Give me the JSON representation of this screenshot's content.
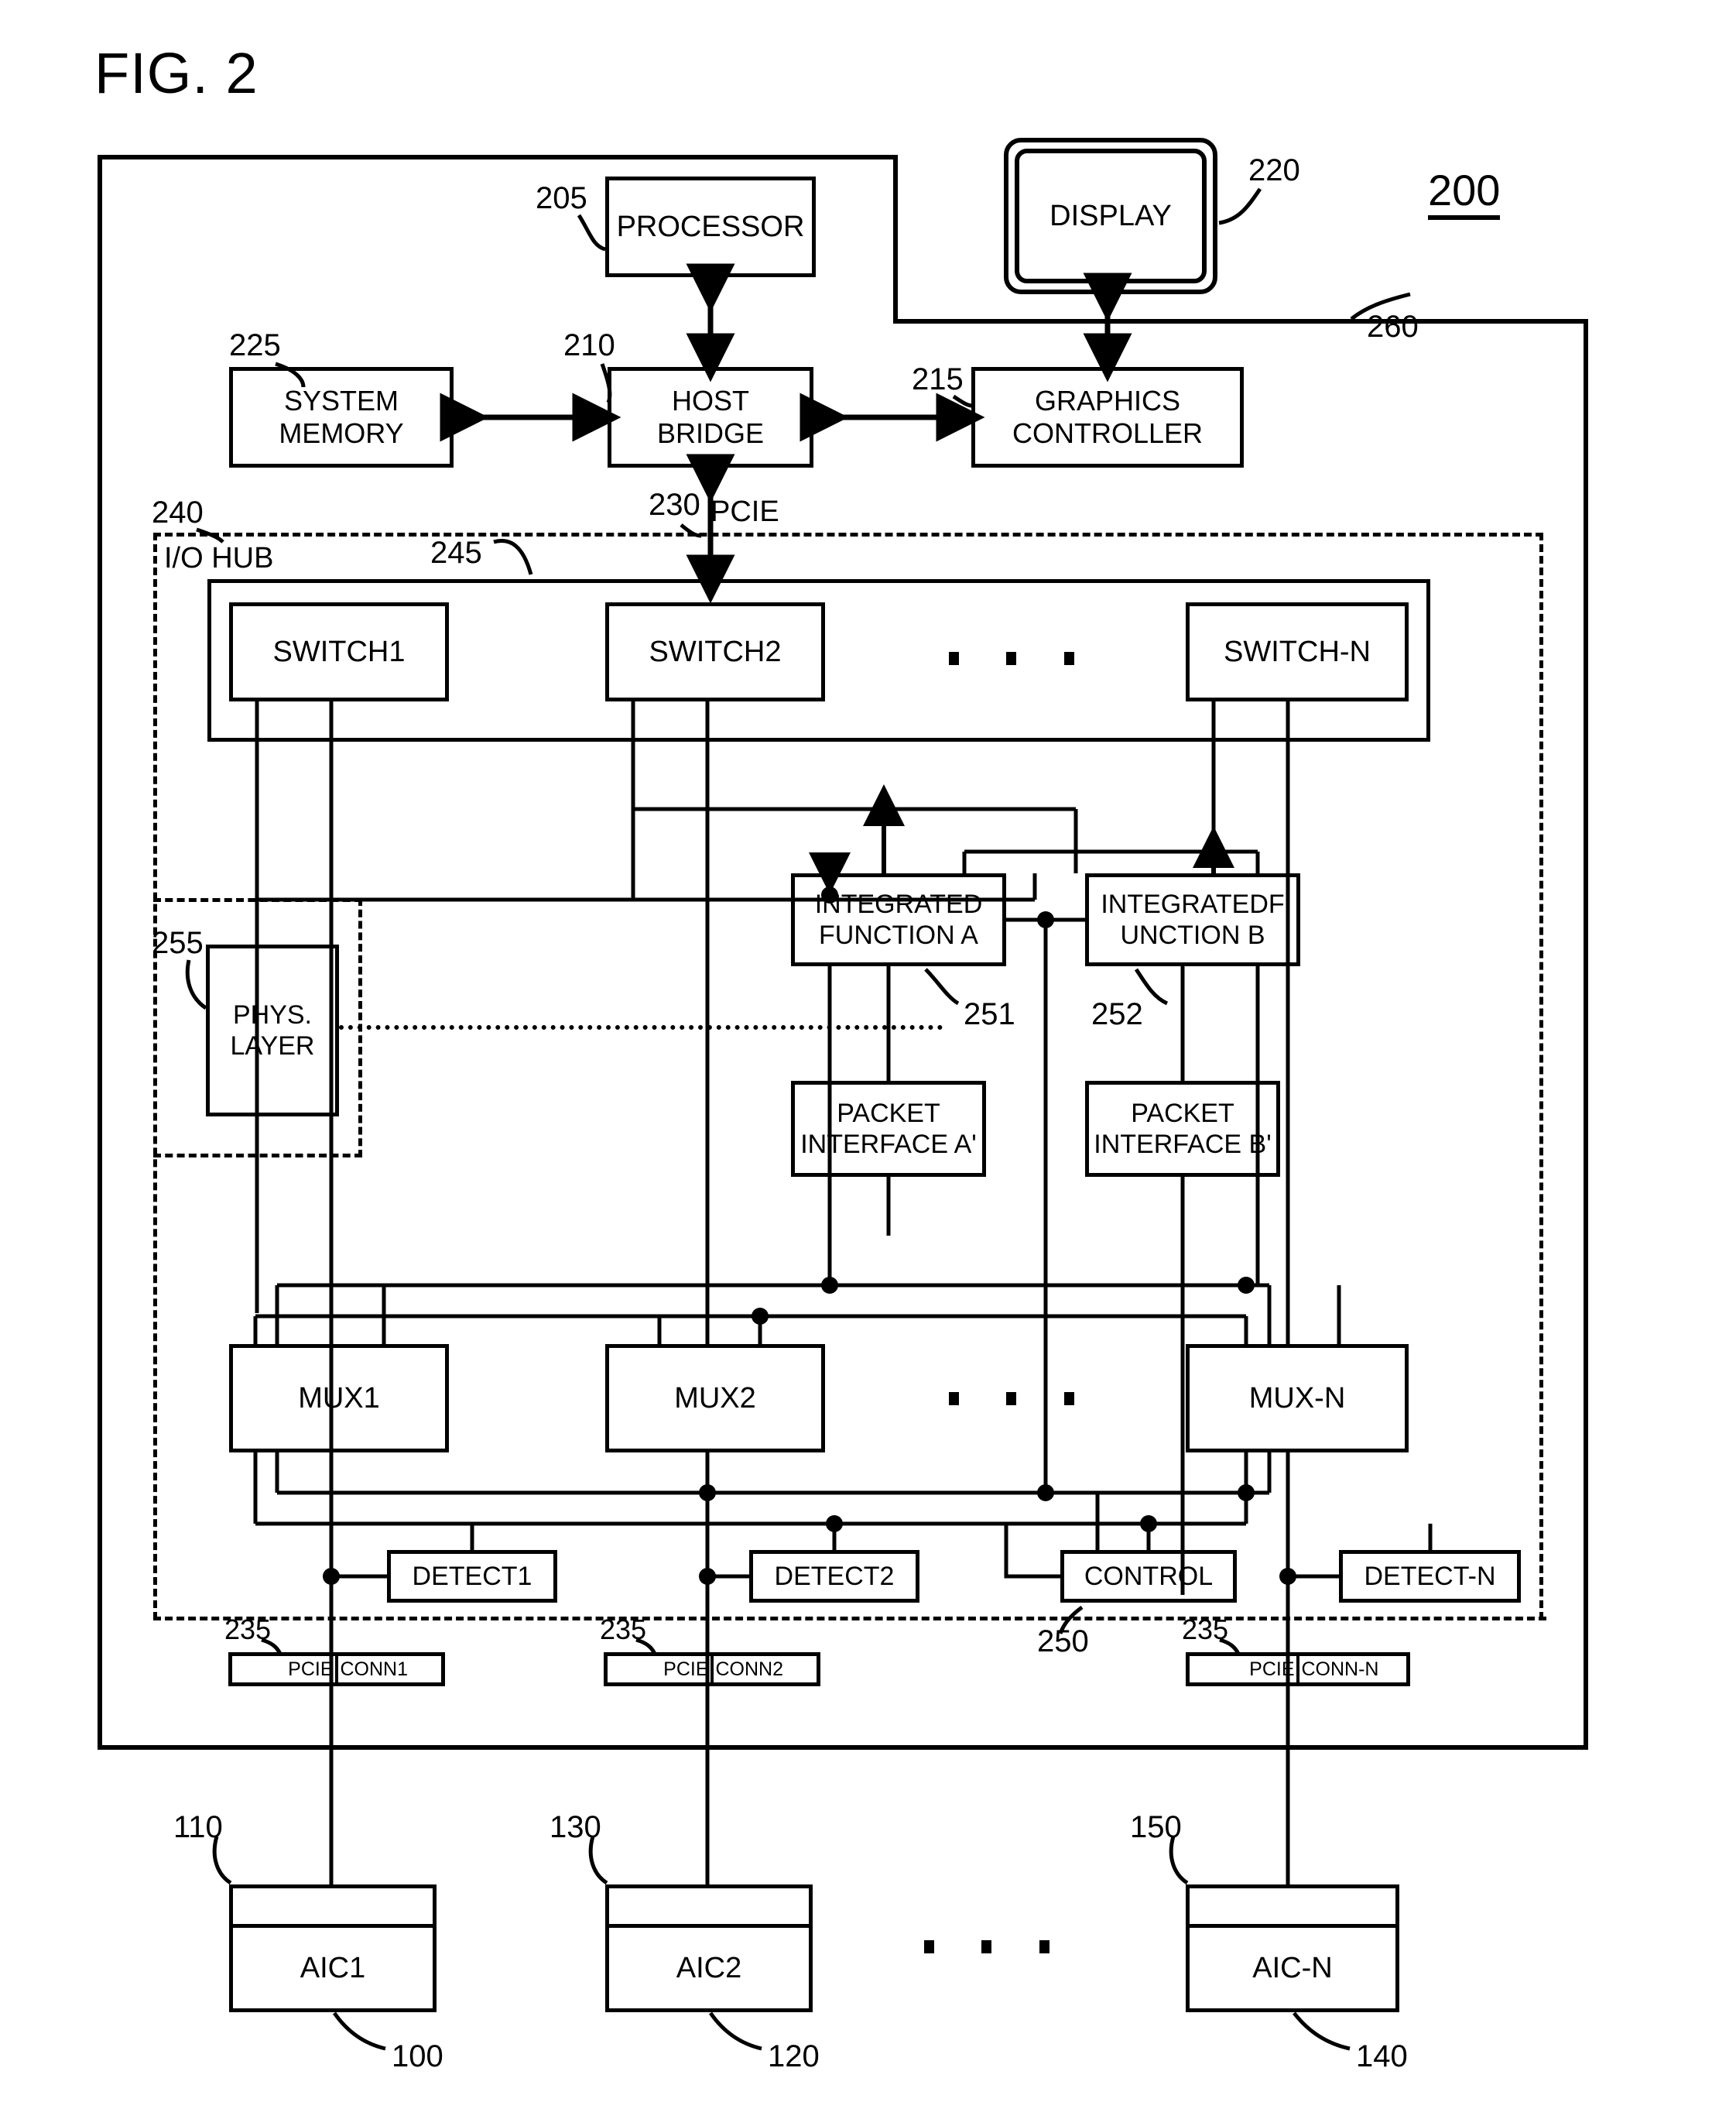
{
  "figure": {
    "title": "FIG. 2",
    "system_ref": "200"
  },
  "blocks": {
    "processor": {
      "label": "PROCESSOR",
      "ref": "205"
    },
    "display": {
      "label": "DISPLAY",
      "ref": "220"
    },
    "system_memory": {
      "label": "SYSTEM\nMEMORY",
      "ref": "225"
    },
    "host_bridge": {
      "label": "HOST\nBRIDGE",
      "ref": "210"
    },
    "graphics": {
      "label": "GRAPHICS\nCONTROLLER",
      "ref": "215"
    },
    "pcie_link": {
      "label": "PCIE",
      "ref": "230"
    },
    "io_hub": {
      "label": "I/O HUB",
      "ref": "240"
    },
    "switch_bus": {
      "ref": "245"
    },
    "switch1": {
      "label": "SWITCH1"
    },
    "switch2": {
      "label": "SWITCH2"
    },
    "switchn": {
      "label": "SWITCH-N"
    },
    "int_func_a": {
      "label": "INTEGRATED\nFUNCTION A",
      "ref": "251"
    },
    "int_func_b": {
      "label": "INTEGRATEDF\nUNCTION B",
      "ref": "252"
    },
    "phys_layer": {
      "label": "PHYS.\nLAYER",
      "ref": "255"
    },
    "pkt_if_a": {
      "label": "PACKET\nINTERFACE A'"
    },
    "pkt_if_b": {
      "label": "PACKET\nINTERFACE B'"
    },
    "mux1": {
      "label": "MUX1"
    },
    "mux2": {
      "label": "MUX2"
    },
    "muxn": {
      "label": "MUX-N"
    },
    "detect1": {
      "label": "DETECT1"
    },
    "detect2": {
      "label": "DETECT2"
    },
    "detectn": {
      "label": "DETECT-N"
    },
    "control": {
      "label": "CONTROL",
      "ref": "250"
    },
    "chassis": {
      "ref": "260"
    }
  },
  "connectors": [
    {
      "left": "PCIE",
      "right": "CONN1",
      "ref": "235"
    },
    {
      "left": "PCIE",
      "right": "CONN2",
      "ref": "235"
    },
    {
      "left": "PCIE",
      "right": "CONN-N",
      "ref": "235"
    }
  ],
  "cards": [
    {
      "label": "AIC1",
      "top_ref": "110",
      "bottom_ref": "100"
    },
    {
      "label": "AIC2",
      "top_ref": "130",
      "bottom_ref": "120"
    },
    {
      "label": "AIC-N",
      "top_ref": "150",
      "bottom_ref": "140"
    }
  ],
  "ellipsis": "• • •"
}
